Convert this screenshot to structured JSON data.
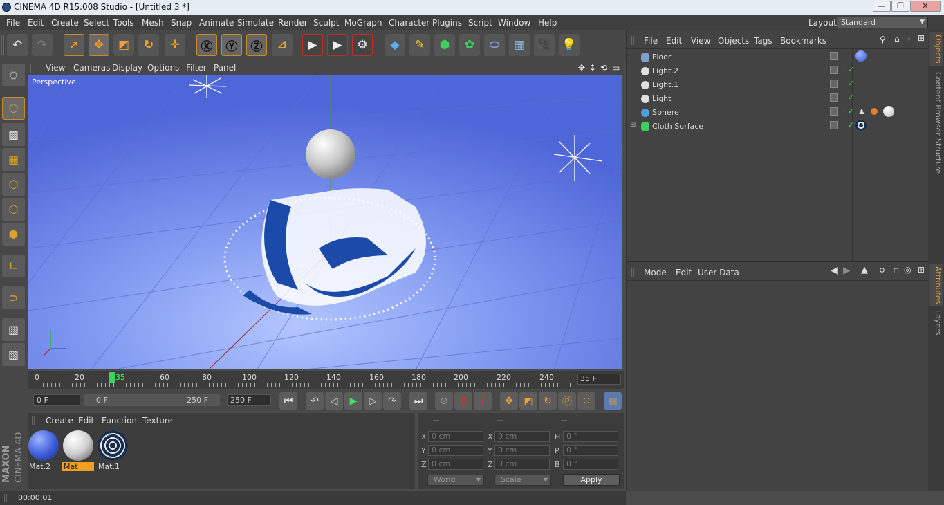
{
  "window": {
    "title": "CINEMA 4D R15.008 Studio - [Untitled 3 *]",
    "controls": [
      "—",
      "❐",
      "✕"
    ]
  },
  "menubar": [
    "File",
    "Edit",
    "Create",
    "Select",
    "Tools",
    "Mesh",
    "Snap",
    "Animate",
    "Simulate",
    "Render",
    "Sculpt",
    "MoGraph",
    "Character",
    "Plugins",
    "Script",
    "Window",
    "Help"
  ],
  "layout": {
    "label": "Layout:",
    "value": "Standard"
  },
  "viewport": {
    "menu": [
      "View",
      "Cameras",
      "Display",
      "Options",
      "Filter",
      "Panel"
    ],
    "label": "Perspective"
  },
  "timeline": {
    "ticks": [
      "0",
      "20",
      "35",
      "60",
      "80",
      "100",
      "120",
      "140",
      "160",
      "180",
      "200",
      "220",
      "240"
    ],
    "current_frame": "35 F"
  },
  "playback": {
    "start": "0 F",
    "range_start": "0 F",
    "range_end": "250 F",
    "end": "250 F"
  },
  "material_manager": {
    "menu": [
      "Create",
      "Edit",
      "Function",
      "Texture"
    ],
    "materials": [
      {
        "name": "Mat.2",
        "color": "#3b5bd8"
      },
      {
        "name": "Mat",
        "color": "#cfcfcf"
      },
      {
        "name": "Mat.1",
        "color": "#1a2e4a"
      }
    ]
  },
  "coordinates": {
    "headers": [
      "--",
      "--",
      "--"
    ],
    "rows": [
      {
        "l1": "X",
        "v1": "0 cm",
        "l2": "X",
        "v2": "0 cm",
        "l3": "H",
        "v3": "0 °"
      },
      {
        "l1": "Y",
        "v1": "0 cm",
        "l2": "Y",
        "v2": "0 cm",
        "l3": "P",
        "v3": "0 °"
      },
      {
        "l1": "Z",
        "v1": "0 cm",
        "l2": "Z",
        "v2": "0 cm",
        "l3": "B",
        "v3": "0 °"
      }
    ],
    "world": "World",
    "scale": "Scale",
    "apply": "Apply"
  },
  "status": "00:00:01",
  "object_manager": {
    "menu": [
      "File",
      "Edit",
      "View",
      "Objects",
      "Tags",
      "Bookmarks"
    ],
    "objects": [
      {
        "name": "Floor",
        "icon_color": "#7fa0c8"
      },
      {
        "name": "Light.2",
        "icon_color": "#e0e0e0"
      },
      {
        "name": "Light.1",
        "icon_color": "#e0e0e0"
      },
      {
        "name": "Light",
        "icon_color": "#e0e0e0"
      },
      {
        "name": "Sphere",
        "icon_color": "#4aa0e0"
      },
      {
        "name": "Cloth Surface",
        "icon_color": "#40d060"
      }
    ]
  },
  "attribute_manager": {
    "menu": [
      "Mode",
      "Edit",
      "User Data"
    ]
  },
  "right_tabs": [
    "Objects",
    "Content Browser",
    "Structure",
    "Attributes",
    "Layers"
  ],
  "branding": {
    "maxon": "MAXON",
    "product": "CINEMA 4D"
  }
}
